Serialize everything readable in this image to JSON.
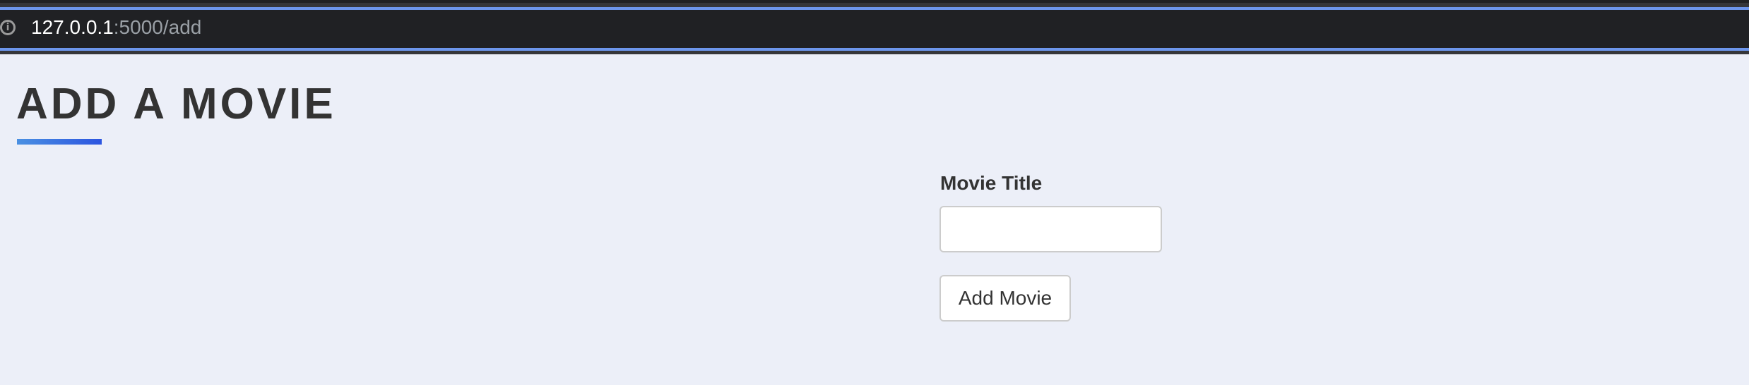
{
  "browser": {
    "url_host": "127.0.0.1",
    "url_rest": ":5000/add",
    "info_icon": "info-icon"
  },
  "page": {
    "title": "ADD A MOVIE",
    "accent_gradient": [
      "#4a90e2",
      "#2c55e0"
    ],
    "form": {
      "label": "Movie Title",
      "value": "",
      "submit_label": "Add Movie"
    }
  }
}
